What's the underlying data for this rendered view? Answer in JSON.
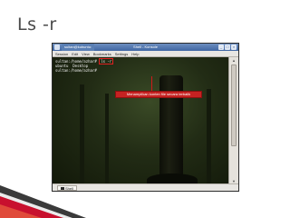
{
  "slide": {
    "title": "Ls -r"
  },
  "window": {
    "title": "Shell - Konsole",
    "tab_title": "sultan@kubuntu:",
    "buttons": [
      "_",
      "□",
      "×"
    ]
  },
  "menu": {
    "items": [
      "Session",
      "Edit",
      "View",
      "Bookmarks",
      "Settings",
      "Help"
    ]
  },
  "terminal": {
    "line1_prompt": "sultan:/home/azhar#",
    "line1_command": "ls -r",
    "line2_output": "ubuntu  Desktop",
    "line3_prompt": "sultan:/home/azhar#"
  },
  "annotation": {
    "text": "Menampilkan konten file secara terbalik"
  },
  "tabbar": {
    "tab_label": "Shell"
  },
  "colors": {
    "title_text": "#4a4a4a",
    "titlebar": "#3f67a3",
    "annotation": "#c62222",
    "swoosh_red": "#c8102e",
    "swoosh_dark": "#3a3a3a"
  }
}
